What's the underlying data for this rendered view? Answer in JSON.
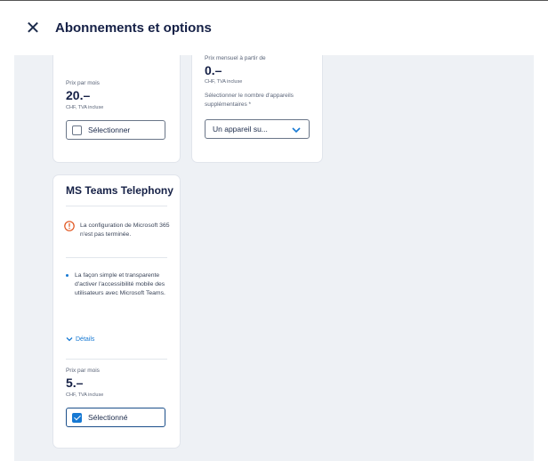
{
  "header": {
    "title": "Abonnements et options"
  },
  "card1": {
    "price_label": "Prix par mois",
    "price": "20.–",
    "vat": "CHF, TVA incluse",
    "button_label": "Sélectionner"
  },
  "card2": {
    "price_label": "Prix mensuel à partir de",
    "price": "0.–",
    "vat": "CHF, TVA incluse",
    "select_label": "Sélectionner le nombre d'appareils supplémentaires *",
    "select_value": "Un appareil su..."
  },
  "card3": {
    "title": "MS Teams Telephony",
    "warning": "La configuration de Microsoft 365 n'est pas terminée.",
    "bullet": "La façon simple et transparente d'activer l'accessibilité mobile des utilisateurs avec Microsoft Teams.",
    "details_label": "Détails",
    "price_label": "Prix par mois",
    "price": "5.–",
    "vat": "CHF, TVA incluse",
    "button_label": "Sélectionné"
  },
  "colors": {
    "accent": "#1779d3",
    "warning": "#e0521b",
    "navy": "#152046",
    "background": "#eef1f5"
  },
  "icons": {
    "close": "close-icon",
    "warning": "warning-icon",
    "chevron": "chevron-down-icon",
    "check": "checkbox-checked-icon"
  }
}
